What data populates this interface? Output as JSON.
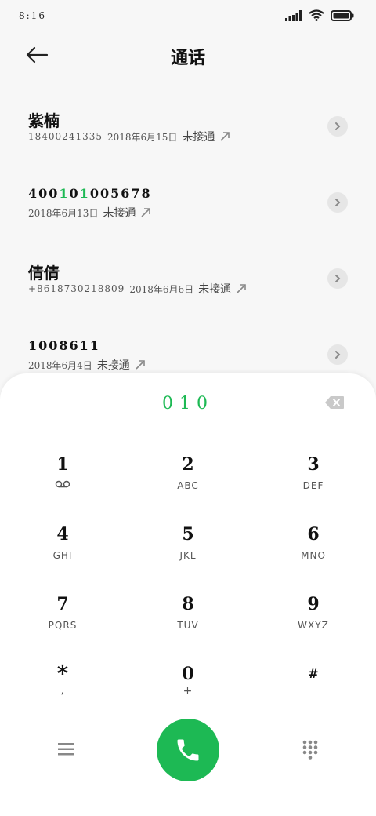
{
  "status": {
    "time": "8:16"
  },
  "header": {
    "title": "通话"
  },
  "calls": [
    {
      "name": "紫楠",
      "number": "18400241335",
      "date": "2018年6月15日",
      "status": "未接通"
    },
    {
      "name_parts": [
        "400",
        "1",
        "0",
        "1",
        "005678"
      ],
      "date": "2018年6月13日",
      "status": "未接通"
    },
    {
      "name": "倩倩",
      "number": "+8618730218809",
      "date": "2018年6月6日",
      "status": "未接通"
    },
    {
      "name": "1008611",
      "date": "2018年6月4日",
      "status": "未接通"
    }
  ],
  "dialpad": {
    "display": "010",
    "keys": [
      {
        "digit": "1",
        "letters": ""
      },
      {
        "digit": "2",
        "letters": "ABC"
      },
      {
        "digit": "3",
        "letters": "DEF"
      },
      {
        "digit": "4",
        "letters": "GHI"
      },
      {
        "digit": "5",
        "letters": "JKL"
      },
      {
        "digit": "6",
        "letters": "MNO"
      },
      {
        "digit": "7",
        "letters": "PQRS"
      },
      {
        "digit": "8",
        "letters": "TUV"
      },
      {
        "digit": "9",
        "letters": "WXYZ"
      },
      {
        "digit": "*",
        "letters": ","
      },
      {
        "digit": "0",
        "letters": "+"
      },
      {
        "digit": "#",
        "letters": ""
      }
    ]
  },
  "icons": {
    "back": "arrow-left-icon",
    "chevron": "chevron-right-icon",
    "outgoing": "outgoing-call-icon",
    "backspace": "backspace-icon",
    "voicemail": "voicemail-icon",
    "menu": "menu-icon",
    "call": "phone-icon",
    "dialpad": "dialpad-icon"
  },
  "colors": {
    "accent": "#1db954"
  }
}
